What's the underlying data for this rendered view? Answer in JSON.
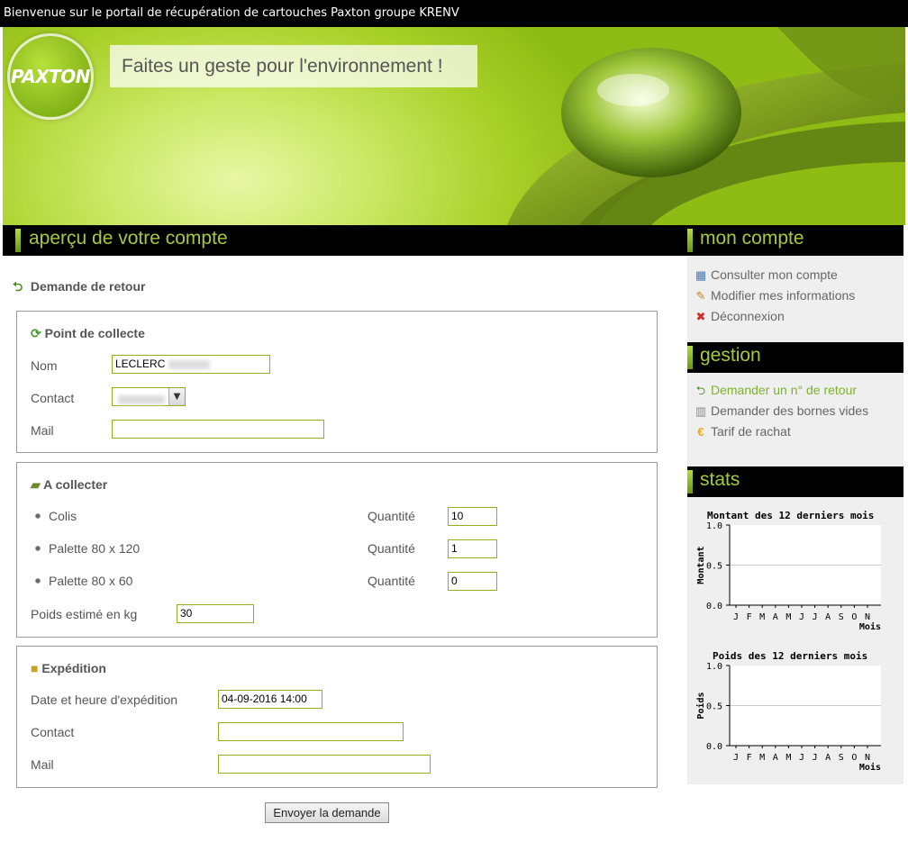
{
  "topbar": {
    "text": "Bienvenue sur le portail de récupération de cartouches Paxton groupe KRENV"
  },
  "banner": {
    "logo_text": "PAXTON",
    "slogan": "Faites un geste pour l'environnement !"
  },
  "main": {
    "section_title": "aperçu de votre compte",
    "request_title": "Demande de retour",
    "collection_point": {
      "title": "Point de collecte",
      "name_label": "Nom",
      "name_value": "LECLERC",
      "contact_label": "Contact",
      "mail_label": "Mail",
      "mail_value": ""
    },
    "to_collect": {
      "title": "A collecter",
      "items": [
        {
          "label": "Colis",
          "qty_label": "Quantité",
          "qty": "10"
        },
        {
          "label": "Palette 80 x 120",
          "qty_label": "Quantité",
          "qty": "1"
        },
        {
          "label": "Palette 80 x 60",
          "qty_label": "Quantité",
          "qty": "0"
        }
      ],
      "weight_label": "Poids estimé en kg",
      "weight_value": "30"
    },
    "shipping": {
      "title": "Expédition",
      "date_label": "Date et heure d'expédition",
      "date_value": "04-09-2016 14:00",
      "contact_label": "Contact",
      "contact_value": "",
      "mail_label": "Mail",
      "mail_value": ""
    },
    "submit_label": "Envoyer la demande"
  },
  "sidebar": {
    "account": {
      "title": "mon compte",
      "links": [
        {
          "label": "Consulter mon compte",
          "icon": "table-icon"
        },
        {
          "label": "Modifier mes informations",
          "icon": "user-edit-icon"
        },
        {
          "label": "Déconnexion",
          "icon": "close-red-icon"
        }
      ]
    },
    "gestion": {
      "title": "gestion",
      "links": [
        {
          "label": "Demander un n° de retour",
          "icon": "return-arrow-icon",
          "active": true
        },
        {
          "label": "Demander des bornes vides",
          "icon": "bin-icon"
        },
        {
          "label": "Tarif de rachat",
          "icon": "euro-icon"
        }
      ]
    },
    "stats": {
      "title": "stats"
    }
  },
  "chart_data": [
    {
      "type": "line",
      "title": "Montant des 12 derniers mois",
      "xlabel": "Mois",
      "ylabel": "Montant",
      "categories": [
        "J",
        "F",
        "M",
        "A",
        "M",
        "J",
        "J",
        "A",
        "S",
        "O",
        "N"
      ],
      "yticks": [
        "1.0",
        "0.5",
        "0.0"
      ],
      "ylim": [
        0,
        1
      ],
      "series": [],
      "grid": true
    },
    {
      "type": "line",
      "title": "Poids des 12 derniers mois",
      "xlabel": "Mois",
      "ylabel": "Poids",
      "categories": [
        "J",
        "F",
        "M",
        "A",
        "M",
        "J",
        "J",
        "A",
        "S",
        "O",
        "N"
      ],
      "yticks": [
        "1.0",
        "0.5",
        "0.0"
      ],
      "ylim": [
        0,
        1
      ],
      "series": [],
      "grid": true
    }
  ],
  "colors": {
    "accent_green": "#a4c93a",
    "header_bg": "#000000",
    "link_active": "#7fb030"
  }
}
